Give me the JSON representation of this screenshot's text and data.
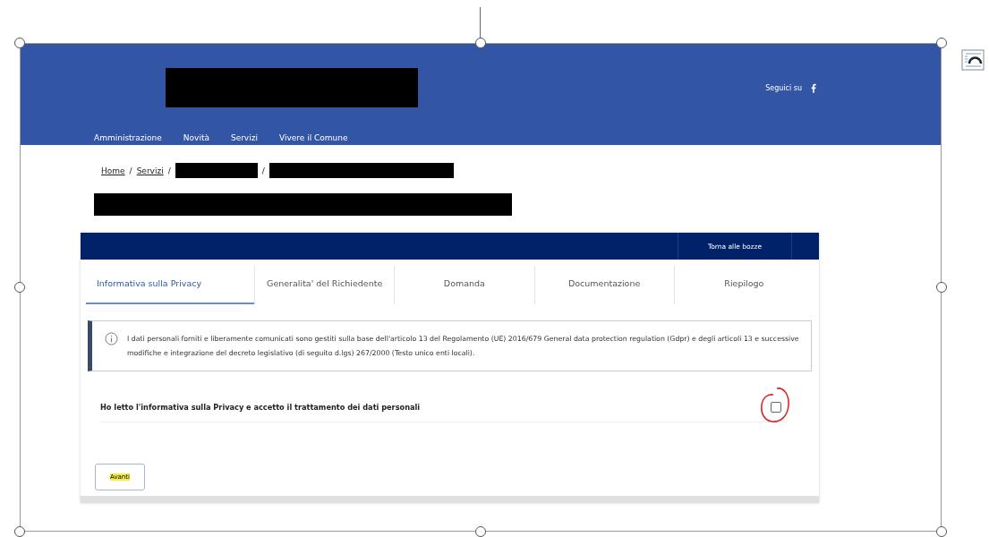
{
  "header": {
    "follow_label": "Seguici su",
    "nav": [
      {
        "label": "Amministrazione"
      },
      {
        "label": "Novità"
      },
      {
        "label": "Servizi"
      },
      {
        "label": "Vivere il Comune"
      }
    ]
  },
  "breadcrumb": [
    {
      "kind": "link",
      "label": "Home"
    },
    {
      "kind": "separator",
      "label": "/"
    },
    {
      "kind": "link",
      "label": "Servizi"
    },
    {
      "kind": "separator",
      "label": "/"
    },
    {
      "kind": "redacted"
    },
    {
      "kind": "separator",
      "label": "/"
    },
    {
      "kind": "redacted"
    }
  ],
  "form": {
    "back_button": "Torna alle bozze",
    "tabs": [
      {
        "label": "Informativa sulla Privacy",
        "selected": true
      },
      {
        "label": "Generalita' del Richiedente",
        "selected": false
      },
      {
        "label": "Domanda",
        "selected": false
      },
      {
        "label": "Documentazione",
        "selected": false
      },
      {
        "label": "Riepilogo",
        "selected": false
      }
    ],
    "info": "I dati personali forniti e liberamente comunicati sono gestiti sulla base dell'articolo 13 del Regolamento (UE) 2016/679 General data protection regulation (Gdpr) e degli articoli 13 e successive modifiche e integrazione del decreto legislativo (di seguito d.lgs) 267/2000 (Testo unico enti locali).",
    "consent": {
      "label": "Ho letto l'informativa sulla Privacy e accetto il trattamento dei dati personali",
      "checked": false
    },
    "next_button": {
      "label": "Avanti",
      "highlighted": true
    }
  }
}
